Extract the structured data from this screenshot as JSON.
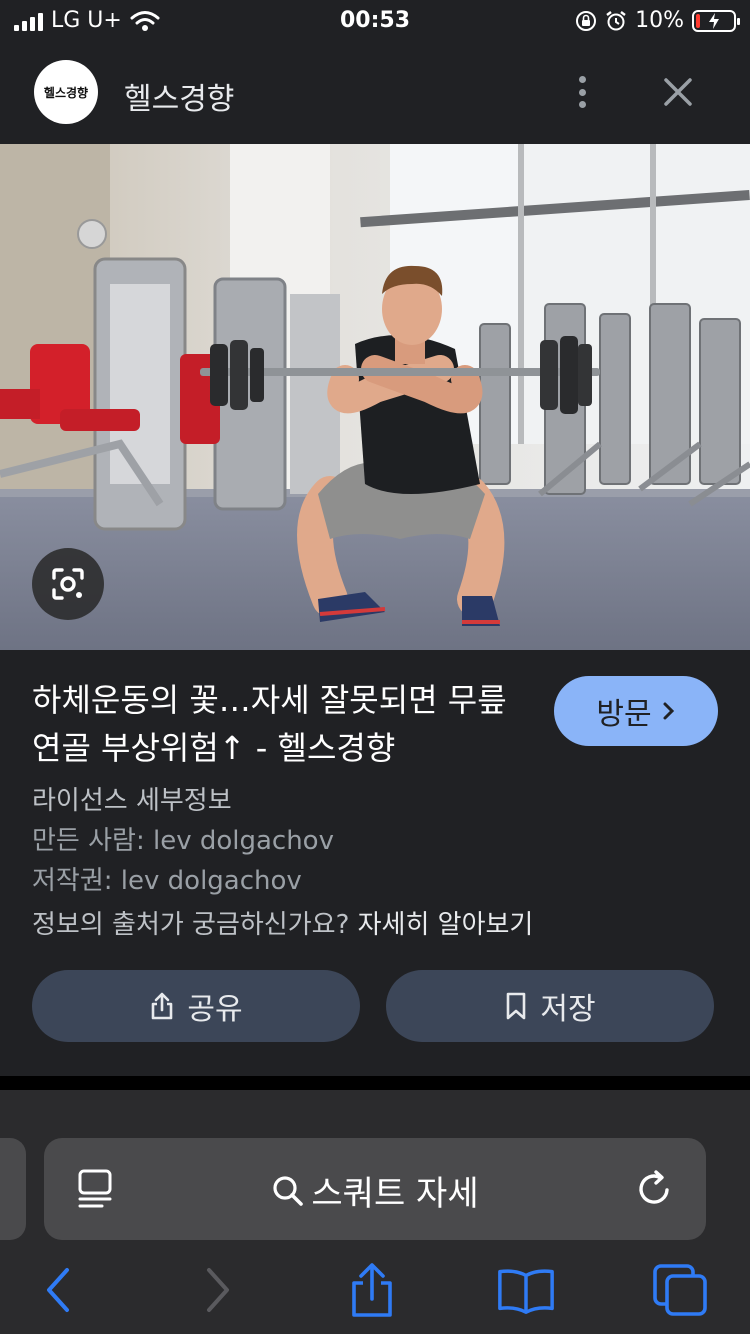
{
  "status_bar": {
    "carrier": "LG U+",
    "time": "00:53",
    "battery_percent": "10%",
    "battery_level": 0.1,
    "icons": [
      "signal-icon",
      "wifi-icon",
      "orientation-lock-icon",
      "alarm-icon",
      "battery-charging-icon"
    ]
  },
  "header": {
    "logo_text": "헬스경향",
    "site_name": "헬스경향",
    "icons": [
      "more-vert-icon",
      "close-icon"
    ]
  },
  "photo": {
    "lens_icon": "google-lens-icon"
  },
  "info": {
    "title": "하체운동의 꽃…자세 잘못되면 무릎연골 부상위험↑ - 헬스경향",
    "visit_label": "방문",
    "license_title": "라이선스 세부정보",
    "creator": "만든 사람: lev dolgachov",
    "copyright": "저작권: lev dolgachov",
    "source_question": "정보의 출처가 궁금하신가요?",
    "source_link": "자세히 알아보기",
    "share_label": "공유",
    "save_label": "저장"
  },
  "browser": {
    "search_query": "스쿼트 자세",
    "icons": [
      "reader-mode-icon",
      "search-icon",
      "reload-icon",
      "back-icon",
      "forward-icon",
      "share-icon",
      "bookmarks-icon",
      "tabs-icon"
    ]
  },
  "colors": {
    "background": "#202124",
    "accent": "#8ab4f8",
    "button_bg": "#3c4658",
    "ios_blue": "#2f7bf5"
  }
}
